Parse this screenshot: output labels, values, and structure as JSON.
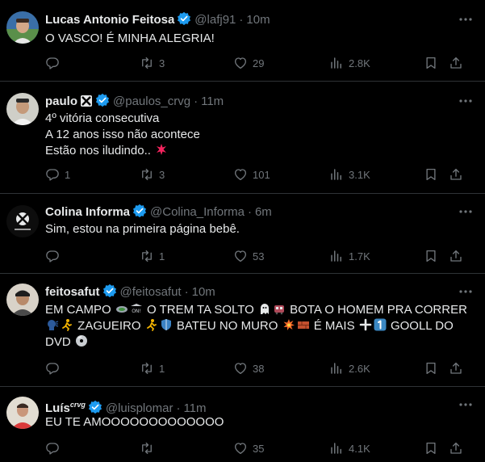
{
  "tweets": [
    {
      "name": "Lucas Antonio Feitosa",
      "handle": "@lafj91",
      "dot": "·",
      "time": "10m",
      "lines": [
        "O VASCO! É MINHA ALEGRIA!"
      ],
      "replies": "",
      "retweets": "3",
      "likes": "29",
      "views": "2.8K"
    },
    {
      "name": "paulo",
      "handle": "@paulos_crvg",
      "dot": "·",
      "time": "11m",
      "lines": [
        "4º vitória consecutiva",
        "A 12 anos isso não acontece",
        "Estão nos iludindo.."
      ],
      "replies": "1",
      "retweets": "3",
      "likes": "101",
      "views": "3.1K"
    },
    {
      "name": "Colina Informa",
      "handle": "@Colina_Informa",
      "dot": "·",
      "time": "6m",
      "lines": [
        "Sim, estou na primeira página bebê."
      ],
      "replies": "",
      "retweets": "1",
      "likes": "53",
      "views": "1.7K"
    },
    {
      "name": "feitosafut",
      "handle": "@feitosafut",
      "dot": "·",
      "time": "10m",
      "lines": [
        {
          "a": "EM CAMPO ",
          "b": " O TREM TA SOLTO ",
          "c": " BOTA O HOMEM PRA CORRER"
        },
        {
          "a": " ZAGUEIRO ",
          "b": " BATEU NO MURO ",
          "c": " É MAIS ",
          "d": " GOOLL DO"
        },
        {
          "a": "DVD "
        }
      ],
      "replies": "",
      "retweets": "1",
      "likes": "38",
      "views": "2.6K"
    },
    {
      "name": "Luís",
      "name_suffix": "crvg",
      "handle": "@luisplomar",
      "dot": "·",
      "time": "11m",
      "lines": [
        "EU TE AMOOOOOOOOOOOOO"
      ],
      "replies": "",
      "retweets": "",
      "likes": "35",
      "views": "4.1K"
    }
  ],
  "colors": {
    "background": "#000000",
    "text": "#e7e9ea",
    "muted": "#71767b",
    "verified": "#1d9bf0",
    "divider": "#2f3336"
  },
  "icons": {
    "reply": "reply-icon",
    "retweet": "retweet-icon",
    "like": "heart-icon",
    "views": "views-icon",
    "bookmark": "bookmark-icon",
    "share": "share-icon",
    "more": "more-icon",
    "verified": "verified-badge-icon"
  }
}
